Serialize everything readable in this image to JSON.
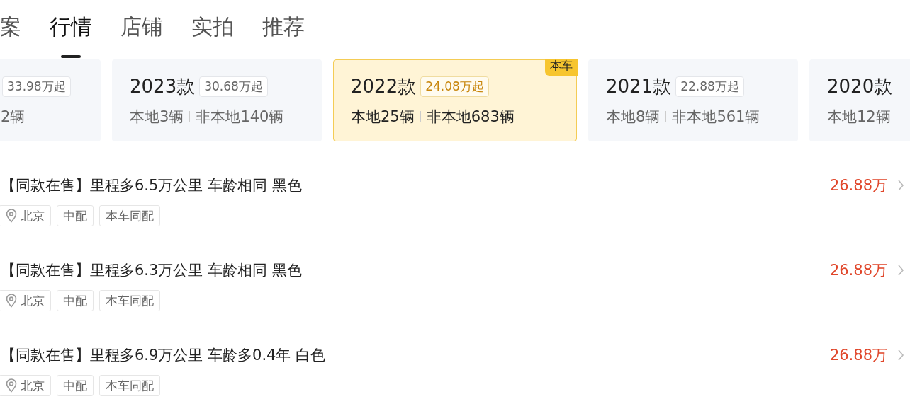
{
  "tabs": [
    {
      "label": "案",
      "selected": false
    },
    {
      "label": "行情",
      "selected": true
    },
    {
      "label": "店铺",
      "selected": false
    },
    {
      "label": "实拍",
      "selected": false
    },
    {
      "label": "推荐",
      "selected": false
    }
  ],
  "year_cards": [
    {
      "price": "33.98万起",
      "local": "2辆",
      "selected": false
    },
    {
      "year": "2023款",
      "price": "30.68万起",
      "local": "本地3辆",
      "nonlocal": "非本地140辆",
      "selected": false
    },
    {
      "year": "2022款",
      "price": "24.08万起",
      "local": "本地25辆",
      "nonlocal": "非本地683辆",
      "selected": true,
      "badge": "本车"
    },
    {
      "year": "2021款",
      "price": "22.88万起",
      "local": "本地8辆",
      "nonlocal": "非本地561辆",
      "selected": false
    },
    {
      "year": "2020款",
      "local": "本地12辆",
      "selected": false
    }
  ],
  "listings": [
    {
      "title": "【同款在售】里程多6.5万公里 车龄相同 黑色",
      "tags": [
        "北京",
        "中配",
        "本车同配"
      ],
      "price": "26.88万"
    },
    {
      "title": "【同款在售】里程多6.3万公里 车龄相同 黑色",
      "tags": [
        "北京",
        "中配",
        "本车同配"
      ],
      "price": "26.88万"
    },
    {
      "title": "【同款在售】里程多6.9万公里 车龄多0.4年 白色",
      "tags": [
        "北京",
        "中配",
        "本车同配"
      ],
      "price": "26.88万"
    }
  ]
}
